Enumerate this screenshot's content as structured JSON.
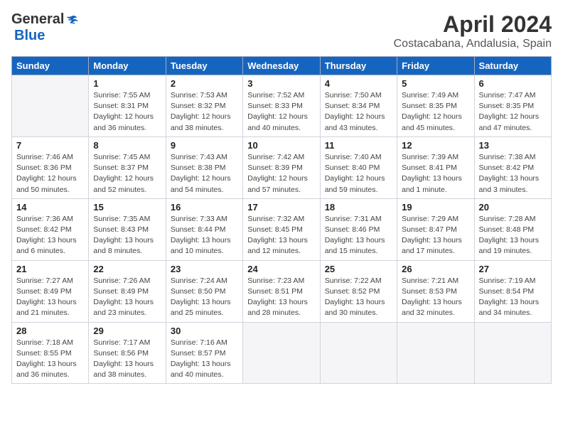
{
  "logo": {
    "general": "General",
    "blue": "Blue"
  },
  "title": "April 2024",
  "subtitle": "Costacabana, Andalusia, Spain",
  "days_header": [
    "Sunday",
    "Monday",
    "Tuesday",
    "Wednesday",
    "Thursday",
    "Friday",
    "Saturday"
  ],
  "weeks": [
    [
      {
        "day": "",
        "info": ""
      },
      {
        "day": "1",
        "info": "Sunrise: 7:55 AM\nSunset: 8:31 PM\nDaylight: 12 hours\nand 36 minutes."
      },
      {
        "day": "2",
        "info": "Sunrise: 7:53 AM\nSunset: 8:32 PM\nDaylight: 12 hours\nand 38 minutes."
      },
      {
        "day": "3",
        "info": "Sunrise: 7:52 AM\nSunset: 8:33 PM\nDaylight: 12 hours\nand 40 minutes."
      },
      {
        "day": "4",
        "info": "Sunrise: 7:50 AM\nSunset: 8:34 PM\nDaylight: 12 hours\nand 43 minutes."
      },
      {
        "day": "5",
        "info": "Sunrise: 7:49 AM\nSunset: 8:35 PM\nDaylight: 12 hours\nand 45 minutes."
      },
      {
        "day": "6",
        "info": "Sunrise: 7:47 AM\nSunset: 8:35 PM\nDaylight: 12 hours\nand 47 minutes."
      }
    ],
    [
      {
        "day": "7",
        "info": "Sunrise: 7:46 AM\nSunset: 8:36 PM\nDaylight: 12 hours\nand 50 minutes."
      },
      {
        "day": "8",
        "info": "Sunrise: 7:45 AM\nSunset: 8:37 PM\nDaylight: 12 hours\nand 52 minutes."
      },
      {
        "day": "9",
        "info": "Sunrise: 7:43 AM\nSunset: 8:38 PM\nDaylight: 12 hours\nand 54 minutes."
      },
      {
        "day": "10",
        "info": "Sunrise: 7:42 AM\nSunset: 8:39 PM\nDaylight: 12 hours\nand 57 minutes."
      },
      {
        "day": "11",
        "info": "Sunrise: 7:40 AM\nSunset: 8:40 PM\nDaylight: 12 hours\nand 59 minutes."
      },
      {
        "day": "12",
        "info": "Sunrise: 7:39 AM\nSunset: 8:41 PM\nDaylight: 13 hours\nand 1 minute."
      },
      {
        "day": "13",
        "info": "Sunrise: 7:38 AM\nSunset: 8:42 PM\nDaylight: 13 hours\nand 3 minutes."
      }
    ],
    [
      {
        "day": "14",
        "info": "Sunrise: 7:36 AM\nSunset: 8:42 PM\nDaylight: 13 hours\nand 6 minutes."
      },
      {
        "day": "15",
        "info": "Sunrise: 7:35 AM\nSunset: 8:43 PM\nDaylight: 13 hours\nand 8 minutes."
      },
      {
        "day": "16",
        "info": "Sunrise: 7:33 AM\nSunset: 8:44 PM\nDaylight: 13 hours\nand 10 minutes."
      },
      {
        "day": "17",
        "info": "Sunrise: 7:32 AM\nSunset: 8:45 PM\nDaylight: 13 hours\nand 12 minutes."
      },
      {
        "day": "18",
        "info": "Sunrise: 7:31 AM\nSunset: 8:46 PM\nDaylight: 13 hours\nand 15 minutes."
      },
      {
        "day": "19",
        "info": "Sunrise: 7:29 AM\nSunset: 8:47 PM\nDaylight: 13 hours\nand 17 minutes."
      },
      {
        "day": "20",
        "info": "Sunrise: 7:28 AM\nSunset: 8:48 PM\nDaylight: 13 hours\nand 19 minutes."
      }
    ],
    [
      {
        "day": "21",
        "info": "Sunrise: 7:27 AM\nSunset: 8:49 PM\nDaylight: 13 hours\nand 21 minutes."
      },
      {
        "day": "22",
        "info": "Sunrise: 7:26 AM\nSunset: 8:49 PM\nDaylight: 13 hours\nand 23 minutes."
      },
      {
        "day": "23",
        "info": "Sunrise: 7:24 AM\nSunset: 8:50 PM\nDaylight: 13 hours\nand 25 minutes."
      },
      {
        "day": "24",
        "info": "Sunrise: 7:23 AM\nSunset: 8:51 PM\nDaylight: 13 hours\nand 28 minutes."
      },
      {
        "day": "25",
        "info": "Sunrise: 7:22 AM\nSunset: 8:52 PM\nDaylight: 13 hours\nand 30 minutes."
      },
      {
        "day": "26",
        "info": "Sunrise: 7:21 AM\nSunset: 8:53 PM\nDaylight: 13 hours\nand 32 minutes."
      },
      {
        "day": "27",
        "info": "Sunrise: 7:19 AM\nSunset: 8:54 PM\nDaylight: 13 hours\nand 34 minutes."
      }
    ],
    [
      {
        "day": "28",
        "info": "Sunrise: 7:18 AM\nSunset: 8:55 PM\nDaylight: 13 hours\nand 36 minutes."
      },
      {
        "day": "29",
        "info": "Sunrise: 7:17 AM\nSunset: 8:56 PM\nDaylight: 13 hours\nand 38 minutes."
      },
      {
        "day": "30",
        "info": "Sunrise: 7:16 AM\nSunset: 8:57 PM\nDaylight: 13 hours\nand 40 minutes."
      },
      {
        "day": "",
        "info": ""
      },
      {
        "day": "",
        "info": ""
      },
      {
        "day": "",
        "info": ""
      },
      {
        "day": "",
        "info": ""
      }
    ]
  ]
}
